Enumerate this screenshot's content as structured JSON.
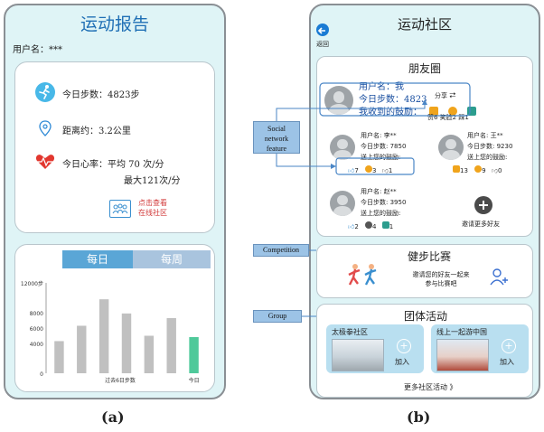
{
  "left": {
    "title": "运动报告",
    "username": "用户名：***",
    "steps": "今日步数：4823步",
    "distance": "距离约：3.2公里",
    "heart_rate_line1": "今日心率：平均 70 次/分",
    "heart_rate_line2": "最大121次/分",
    "community_link_line1": "点击查看",
    "community_link_line2": "在线社区",
    "tab_daily": "每日",
    "tab_weekly": "每周",
    "caption": "(a)"
  },
  "chart_data": {
    "type": "bar",
    "categories": [
      "",
      "",
      "",
      "",
      "",
      "",
      "今日"
    ],
    "values": [
      4300,
      6300,
      9800,
      7900,
      5000,
      7300,
      4823
    ],
    "ylim": [
      0,
      12000
    ],
    "yticks": [
      "12000步",
      "8000",
      "6000",
      "4000",
      "0"
    ],
    "xlabel": "过去6日步数",
    "colors": {
      "past": "#c0c0c0",
      "today": "#4fc99a"
    }
  },
  "right": {
    "title": "运动社区",
    "back_label": "返回",
    "moments_title": "朋友圈",
    "me": {
      "username": "用户名：我",
      "steps": "今日步数：4823",
      "received": "我收到的鼓励：",
      "share_label": "分享",
      "counts_text": "赞6  笑脸2  踩1"
    },
    "friends": [
      {
        "name": "用户名: 李**",
        "steps": "今日步数: 7850",
        "cheer": "送上您的鼓励:",
        "likes": "7",
        "smiles": "3",
        "dislikes": "1"
      },
      {
        "name": "用户名: 王**",
        "steps": "今日步数: 9230",
        "cheer": "送上您的鼓励:",
        "likes": "13",
        "smiles": "9",
        "dislikes": "0"
      },
      {
        "name": "用户名: 赵**",
        "steps": "今日步数: 3950",
        "cheer": "送上您的鼓励:",
        "likes": "2",
        "smiles": "4",
        "dislikes": "1"
      }
    ],
    "invite_more": "邀请更多好友",
    "competition_title": "健步比赛",
    "competition_line1": "邀请您的好友一起来",
    "competition_line2": "参与比赛吧",
    "group_title": "团体活动",
    "groups": [
      {
        "name": "太极拳社区",
        "join": "加入"
      },
      {
        "name": "线上一起游中国",
        "join": "加入"
      }
    ],
    "more_activities": "更多社区活动 》",
    "caption": "(b)"
  },
  "callouts": {
    "social_line1": "Social",
    "social_line2": "network",
    "social_line3": "feature",
    "competition": "Competition",
    "group": "Group"
  },
  "colors": {
    "phone_bg": "#dff4f6",
    "callout": "#9cc3e6",
    "accent_blue": "#1a7bd4",
    "tab_active": "#5aa6d6",
    "tab_inactive": "#a9c4de",
    "link_red": "#d23b3b"
  }
}
